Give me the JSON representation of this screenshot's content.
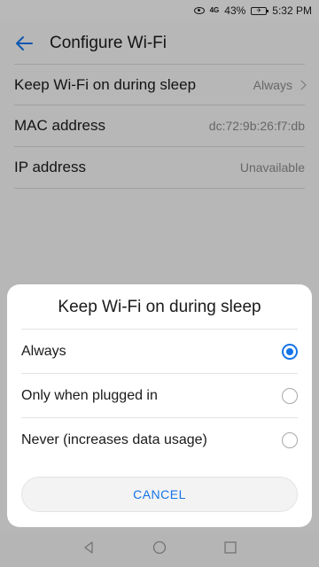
{
  "status_bar": {
    "signal_text": "4G",
    "battery": "43%",
    "airplane_icon": "airplane-icon",
    "time": "5:32 PM"
  },
  "app_bar": {
    "title": "Configure Wi-Fi"
  },
  "settings": [
    {
      "label": "Keep Wi-Fi on during sleep",
      "value": "Always"
    },
    {
      "label": "MAC address",
      "value": "dc:72:9b:26:f7:db"
    },
    {
      "label": "IP address",
      "value": "Unavailable"
    }
  ],
  "dialog": {
    "title": "Keep Wi-Fi on during sleep",
    "options": [
      {
        "label": "Always",
        "selected": true
      },
      {
        "label": "Only when plugged in",
        "selected": false
      },
      {
        "label": "Never (increases data usage)",
        "selected": false
      }
    ],
    "cancel_label": "CANCEL"
  },
  "colors": {
    "accent": "#1474e8"
  }
}
